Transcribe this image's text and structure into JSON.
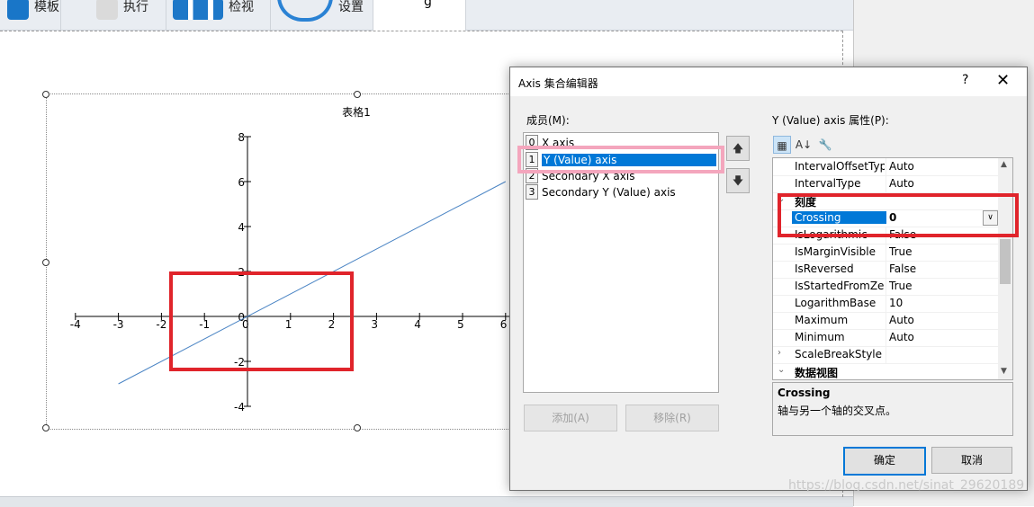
{
  "toolbar": {
    "buttons": [
      {
        "label": "模板"
      },
      {
        "label": "执行"
      },
      {
        "label": "检视"
      },
      {
        "label": "设置"
      }
    ],
    "active_tab_label": "g"
  },
  "chart_data": {
    "type": "line",
    "title": "表格1",
    "xlim": [
      -4,
      6
    ],
    "ylim": [
      -4,
      8
    ],
    "x_ticks": [
      -4,
      -3,
      -2,
      -1,
      0,
      1,
      2,
      3,
      4,
      5,
      6
    ],
    "y_ticks": [
      -4,
      -2,
      0,
      2,
      4,
      6,
      8
    ],
    "series": [
      {
        "x": [
          -3,
          6
        ],
        "y": [
          -3,
          6
        ],
        "color": "#4a84c4"
      }
    ],
    "grid": false
  },
  "dialog": {
    "title": "Axis 集合编辑器",
    "help": "?",
    "close": "✕",
    "members_label": "成员(M):",
    "members": [
      {
        "index": "0",
        "name": "X axis"
      },
      {
        "index": "1",
        "name": "Y (Value) axis"
      },
      {
        "index": "2",
        "name": "Secondary X axis"
      },
      {
        "index": "3",
        "name": "Secondary Y (Value) axis"
      }
    ],
    "up_arrow": "🡅",
    "down_arrow": "🡇",
    "add_label": "添加(A)",
    "remove_label": "移除(R)",
    "props_label": "Y (Value) axis 属性(P):",
    "prop_tools": [
      "▦",
      "A↓",
      "🔧"
    ],
    "properties": [
      {
        "name": "IntervalOffsetTyp",
        "value": "Auto"
      },
      {
        "name": "IntervalType",
        "value": "Auto"
      },
      {
        "name": "刻度",
        "value": "",
        "category": true
      },
      {
        "name": "Crossing",
        "value": "0",
        "selected": true
      },
      {
        "name": "IsLogarithmic",
        "value": "False"
      },
      {
        "name": "IsMarginVisible",
        "value": "True"
      },
      {
        "name": "IsReversed",
        "value": "False"
      },
      {
        "name": "IsStartedFromZer",
        "value": "True"
      },
      {
        "name": "LogarithmBase",
        "value": "10"
      },
      {
        "name": "Maximum",
        "value": "Auto"
      },
      {
        "name": "Minimum",
        "value": "Auto"
      },
      {
        "name": "ScaleBreakStyle",
        "value": ""
      },
      {
        "name": "数据视图",
        "value": "",
        "category": true
      }
    ],
    "dropdown_glyph": "∨",
    "description_title": "Crossing",
    "description_text": "轴与另一个轴的交叉点。",
    "ok_label": "确定",
    "cancel_label": "取消"
  },
  "watermark": "https://blog.csdn.net/sinat_29620189"
}
